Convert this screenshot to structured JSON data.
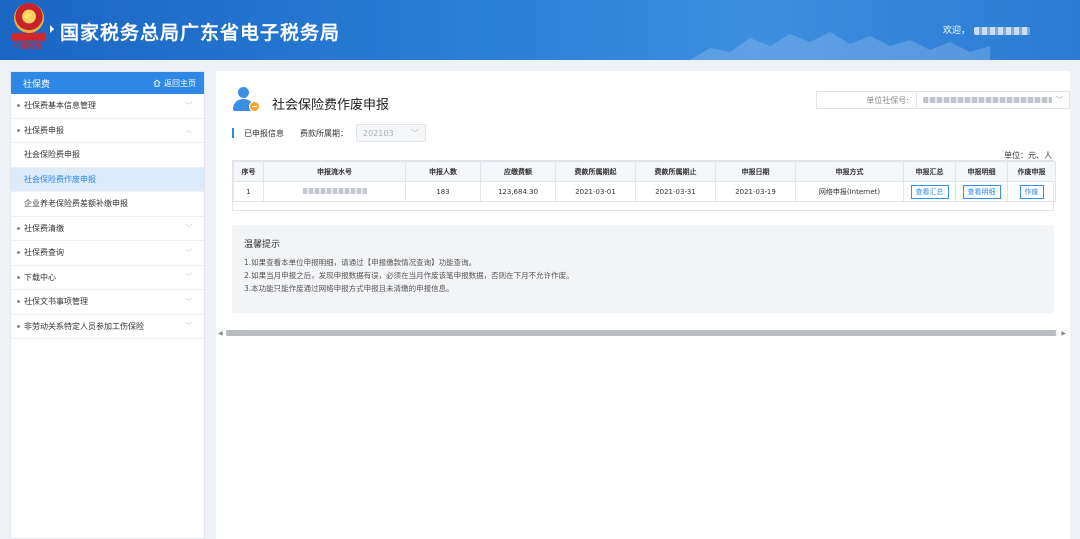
{
  "header": {
    "site_title": "国家税务总局广东省电子税务局",
    "seal_text": "中国税务",
    "welcome": "欢迎，"
  },
  "sidebar": {
    "title": "社保费",
    "home_link": "返回主页",
    "items": [
      {
        "label": "社保费基本信息管理",
        "expanded": false
      },
      {
        "label": "社保费申报",
        "expanded": true
      },
      {
        "label": "社保费清缴",
        "expanded": false
      },
      {
        "label": "社保费查询",
        "expanded": false
      },
      {
        "label": "下载中心",
        "expanded": false
      },
      {
        "label": "社保文书事项管理",
        "expanded": false
      },
      {
        "label": "非劳动关系特定人员参加工伤保险",
        "expanded": false
      }
    ],
    "sub_items": [
      {
        "label": "社会保险费申报",
        "active": false
      },
      {
        "label": "社会保险费作废申报",
        "active": true
      },
      {
        "label": "企业养老保险费差额补缴申报",
        "active": false
      }
    ]
  },
  "main": {
    "page_title": "社会保险费作废申报",
    "unit_label": "单位社保号:",
    "declared_info": "已申报信息",
    "period_label": "费款所属期：",
    "period_value": "202103",
    "unit_note": "单位：元、人",
    "table": {
      "headers": [
        "序号",
        "申报流水号",
        "申报人数",
        "应缴费额",
        "费款所属期起",
        "费款所属期止",
        "申报日期",
        "申报方式",
        "申报汇总",
        "申报明细",
        "作废申报"
      ],
      "rows": [
        {
          "index": "1",
          "count": "183",
          "amount": "123,684.30",
          "period_start": "2021-03-01",
          "period_end": "2021-03-31",
          "date": "2021-03-19",
          "method": "网络申报(Internet)",
          "summary_btn": "查看汇总",
          "detail_btn": "查看明细",
          "void_btn": "作废"
        }
      ]
    },
    "tips": {
      "title": "温馨提示",
      "lines": [
        "1.如果查看本单位申报明细，请通过【申报缴款情况查询】功能查询。",
        "2.如果当月申报之后，发现申报数据有误，必须在当月作废该笔申报数据，否则在下月不允许作废。",
        "3.本功能只能作废通过网络申报方式申报且未清缴的申报信息。"
      ]
    }
  },
  "colors": {
    "header_blue": "#1a66c4",
    "accent_blue": "#2d89e5",
    "active_bg": "#dceafa",
    "badge_orange": "#f5a623"
  },
  "icons": [
    "tax-emblem-icon",
    "home-icon",
    "chevron-down-icon",
    "chevron-up-icon",
    "user-icon"
  ]
}
